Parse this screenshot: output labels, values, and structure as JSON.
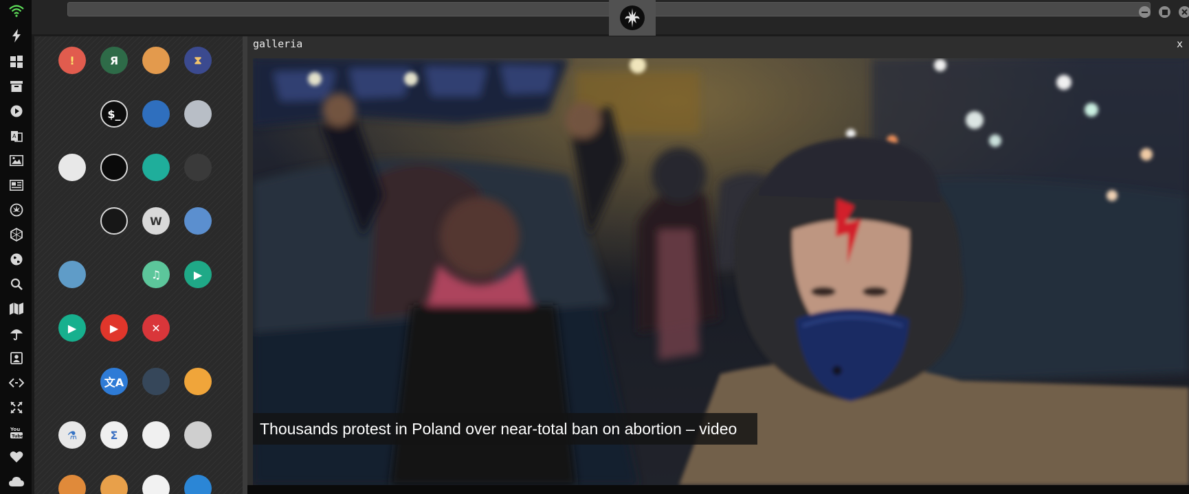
{
  "window": {
    "brand_icon": "rebel-alliance-icon",
    "controls": [
      "minimize-icon",
      "maximize-icon",
      "close-icon"
    ]
  },
  "dock": {
    "icons": [
      "wifi-icon",
      "lightning-icon",
      "windows-icon",
      "archive-icon",
      "play-icon",
      "translate-book-icon",
      "image-icon",
      "newspaper-icon",
      "rebel-icon",
      "hexagon-icon",
      "globe-icon",
      "search-icon",
      "map-icon",
      "umbrella-icon",
      "contact-icon",
      "code-icon",
      "fullscreen-icon",
      "youtube-icon",
      "heart-icon",
      "cloud-icon"
    ]
  },
  "launcher": {
    "apps": [
      {
        "name": "warning-app-icon",
        "glyph": "!",
        "bg": "#e15c4e",
        "fg": "#fbe36b"
      },
      {
        "name": "yandex-app-icon",
        "glyph": "Я",
        "bg": "#2e6b48",
        "fg": "#ffffff"
      },
      {
        "name": "magnifier-app-icon",
        "glyph": "",
        "bg": "#e39a4d",
        "fg": "#ffffff"
      },
      {
        "name": "hourglass-app-icon",
        "glyph": "⧗",
        "bg": "#3b4a8f",
        "fg": "#f2c46b"
      },
      {
        "name": "prompt-arrow-app-icon",
        "glyph": "",
        "bg": "transparent",
        "fg": "#ef7d2c"
      },
      {
        "name": "terminal-app-icon",
        "glyph": "$_",
        "bg": "#0d0d0d",
        "fg": "#ffffff"
      },
      {
        "name": "globe-app-icon",
        "glyph": "",
        "bg": "#2f6fbe",
        "fg": "#ffffff"
      },
      {
        "name": "server-app-icon",
        "glyph": "",
        "bg": "#b8bec6",
        "fg": "#555555"
      },
      {
        "name": "browser-window-app-icon",
        "glyph": "",
        "bg": "#e8e8e8",
        "fg": "#444444"
      },
      {
        "name": "cloud-terminal-app-icon",
        "glyph": "",
        "bg": "#0a0a0a",
        "fg": "#ffffff"
      },
      {
        "name": "cloud-lock-app-icon",
        "glyph": "",
        "bg": "#1fae9b",
        "fg": "#ffffff"
      },
      {
        "name": "github-app-icon",
        "glyph": "",
        "bg": "#3a3a3a",
        "fg": "#ffffff"
      },
      {
        "name": "starfleet-app-icon",
        "glyph": "",
        "bg": "transparent",
        "fg": "#222222"
      },
      {
        "name": "death-star-app-icon",
        "glyph": "",
        "bg": "#171717",
        "fg": "#777777"
      },
      {
        "name": "wikipedia-app-icon",
        "glyph": "W",
        "bg": "#d9d9d9",
        "fg": "#333333"
      },
      {
        "name": "world-map-app-icon",
        "glyph": "",
        "bg": "#5b8fcf",
        "fg": "#d8c24a"
      },
      {
        "name": "books-app-icon",
        "glyph": "",
        "bg": "#5f9cc8",
        "fg": "#e8e8e8"
      },
      {
        "name": "document-app-icon",
        "glyph": "",
        "bg": "transparent",
        "fg": "#e6e6e6"
      },
      {
        "name": "music-app-icon",
        "glyph": "♫",
        "bg": "#5cc69b",
        "fg": "#ffffff"
      },
      {
        "name": "video-app-icon",
        "glyph": "▶",
        "bg": "#1fa987",
        "fg": "#ffffff"
      },
      {
        "name": "media-player-app-icon",
        "glyph": "▶",
        "bg": "#17b08e",
        "fg": "#ffffff"
      },
      {
        "name": "youtube-player-app-icon",
        "glyph": "▶",
        "bg": "#e0362b",
        "fg": "#ffffff"
      },
      {
        "name": "close-circle-app-icon",
        "glyph": "✕",
        "bg": "#d9363a",
        "fg": "#ffffff"
      },
      {
        "name": "ironman-app-icon",
        "glyph": "",
        "bg": "transparent",
        "fg": "#c0392b"
      },
      {
        "name": "c3po-app-icon",
        "glyph": "",
        "bg": "transparent",
        "fg": "#d8b13a"
      },
      {
        "name": "translate-app-icon",
        "glyph": "文A",
        "bg": "#2e7bd6",
        "fg": "#ffffff"
      },
      {
        "name": "calculator-app-icon",
        "glyph": "",
        "bg": "#36475a",
        "fg": "#ffffff"
      },
      {
        "name": "screenshot-app-icon",
        "glyph": "",
        "bg": "#f0a53a",
        "fg": "#ffffff"
      },
      {
        "name": "chemistry-flask-app-icon",
        "glyph": "⚗",
        "bg": "#e8e8e8",
        "fg": "#3472c4"
      },
      {
        "name": "sigma-math-app-icon",
        "glyph": "Σ",
        "bg": "#f0f0f0",
        "fg": "#3a6fc2"
      },
      {
        "name": "binary-file-app-icon",
        "glyph": "",
        "bg": "#f0f0f0",
        "fg": "#555555"
      },
      {
        "name": "text-editor-app-icon",
        "glyph": "",
        "bg": "#cfcfcf",
        "fg": "#6a6a6a"
      },
      {
        "name": "document-orange-app-icon",
        "glyph": "",
        "bg": "#e08a3a",
        "fg": "#ffffff"
      },
      {
        "name": "image-viewer-app-icon",
        "glyph": "",
        "bg": "#e8a04a",
        "fg": "#ffffff"
      },
      {
        "name": "presentation-app-icon",
        "glyph": "",
        "bg": "#f2f2f2",
        "fg": "#c0392b"
      },
      {
        "name": "vscode-app-icon",
        "glyph": "",
        "bg": "#2b86d6",
        "fg": "#ffffff"
      }
    ]
  },
  "gallery": {
    "title": "galleria",
    "close_label": "x",
    "caption": "Thousands protest in Poland over near-total ban on abortion – video"
  }
}
